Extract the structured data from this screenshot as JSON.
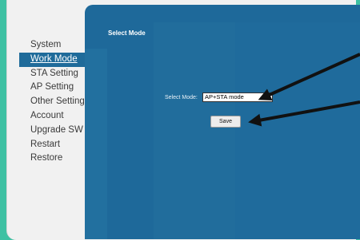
{
  "sidebar": {
    "items": [
      {
        "label": "System",
        "active": false
      },
      {
        "label": "Work Mode",
        "active": true
      },
      {
        "label": "STA Setting",
        "active": false
      },
      {
        "label": "AP Setting",
        "active": false
      },
      {
        "label": "Other Setting",
        "active": false
      },
      {
        "label": "Account",
        "active": false
      },
      {
        "label": "Upgrade SW",
        "active": false
      },
      {
        "label": "Restart",
        "active": false
      },
      {
        "label": "Restore",
        "active": false
      }
    ]
  },
  "main": {
    "heading": "Select Mode",
    "select_label": "Select Mode:",
    "select_value": "AP+STA mode",
    "save_label": "Save"
  },
  "colors": {
    "accent_teal": "#3ec1a3",
    "panel_blue": "#1e699a",
    "active_item": "#1f6b9a"
  }
}
